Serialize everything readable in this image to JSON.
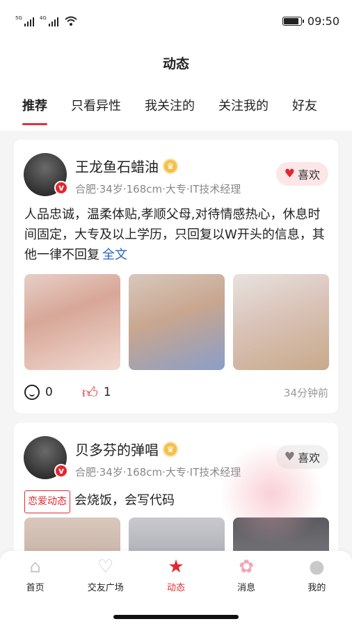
{
  "status_bar": {
    "sig1": "5G",
    "sig2": "4G",
    "wifi_label": "6",
    "time": "09:50"
  },
  "header": {
    "title": "动态"
  },
  "tabs": [
    "推荐",
    "只看异性",
    "我关注的",
    "关注我的",
    "好友"
  ],
  "posts": [
    {
      "name": "王龙鱼石蜡油",
      "meta": "合肥·34岁·168cm·大专·IT技术经理",
      "like_label": "喜欢",
      "liked": true,
      "text": "人品忠诚，温柔体贴,孝顺父母,对待情感热心，休息时间固定，大专及以上学历，只回复以W开头的信息，其他一律不回复",
      "more": "全文",
      "comments": "0",
      "likes": "1",
      "time": "34分钟前"
    },
    {
      "name": "贝多芬的弹唱",
      "meta": "合肥·34岁·168cm·大专·IT技术经理",
      "like_label": "喜欢",
      "liked": false,
      "tag": "恋爱动态",
      "text": "会烧饭，会写代码"
    }
  ],
  "nav": [
    {
      "label": "首页",
      "icon": "home-icon"
    },
    {
      "label": "交友广场",
      "icon": "hearts-icon"
    },
    {
      "label": "动态",
      "icon": "star-icon"
    },
    {
      "label": "消息",
      "icon": "flower-icon"
    },
    {
      "label": "我的",
      "icon": "person-icon"
    }
  ],
  "colors": {
    "accent": "#e2282f",
    "link": "#2d63c8"
  }
}
